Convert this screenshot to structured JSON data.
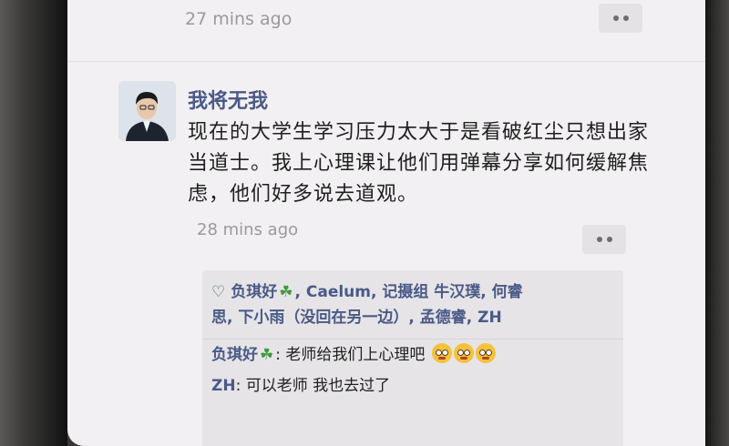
{
  "previous_post": {
    "time": "27 mins ago"
  },
  "post": {
    "author": "我将无我",
    "text": "现在的大学生学习压力太大于是看破红尘只想出家当道士。我上心理课让他们用弹幕分享如何缓解焦虑，他们好多说去道观。",
    "time": "28 mins ago"
  },
  "likes": {
    "names": [
      "负琪好",
      "Caelum",
      "记摄组 牛汉璞",
      "何睿思",
      "下小雨（没回在另一边）",
      "孟德睿",
      "ZH"
    ],
    "line1": ", Caelum, 记摄组 牛汉璞, 何睿",
    "line2": "思, 下小雨（没回在另一边）, 孟德睿, ZH",
    "first": "负琪好"
  },
  "comments": [
    {
      "author": "负琪好",
      "separator": ": ",
      "text": "老师给我们上心理吧"
    },
    {
      "author": "ZH",
      "separator": ": ",
      "text": "可以老师 我也去过了"
    }
  ],
  "icons": {
    "more": "more-dots-icon",
    "heart": "heart-outline-icon",
    "clover": "four-leaf-clover-icon",
    "emoji": "pleading-face-emoji"
  },
  "colors": {
    "nickname": "#4a5a86",
    "background": "#f2f0f2",
    "interaction_box": "#e6e4e7"
  }
}
